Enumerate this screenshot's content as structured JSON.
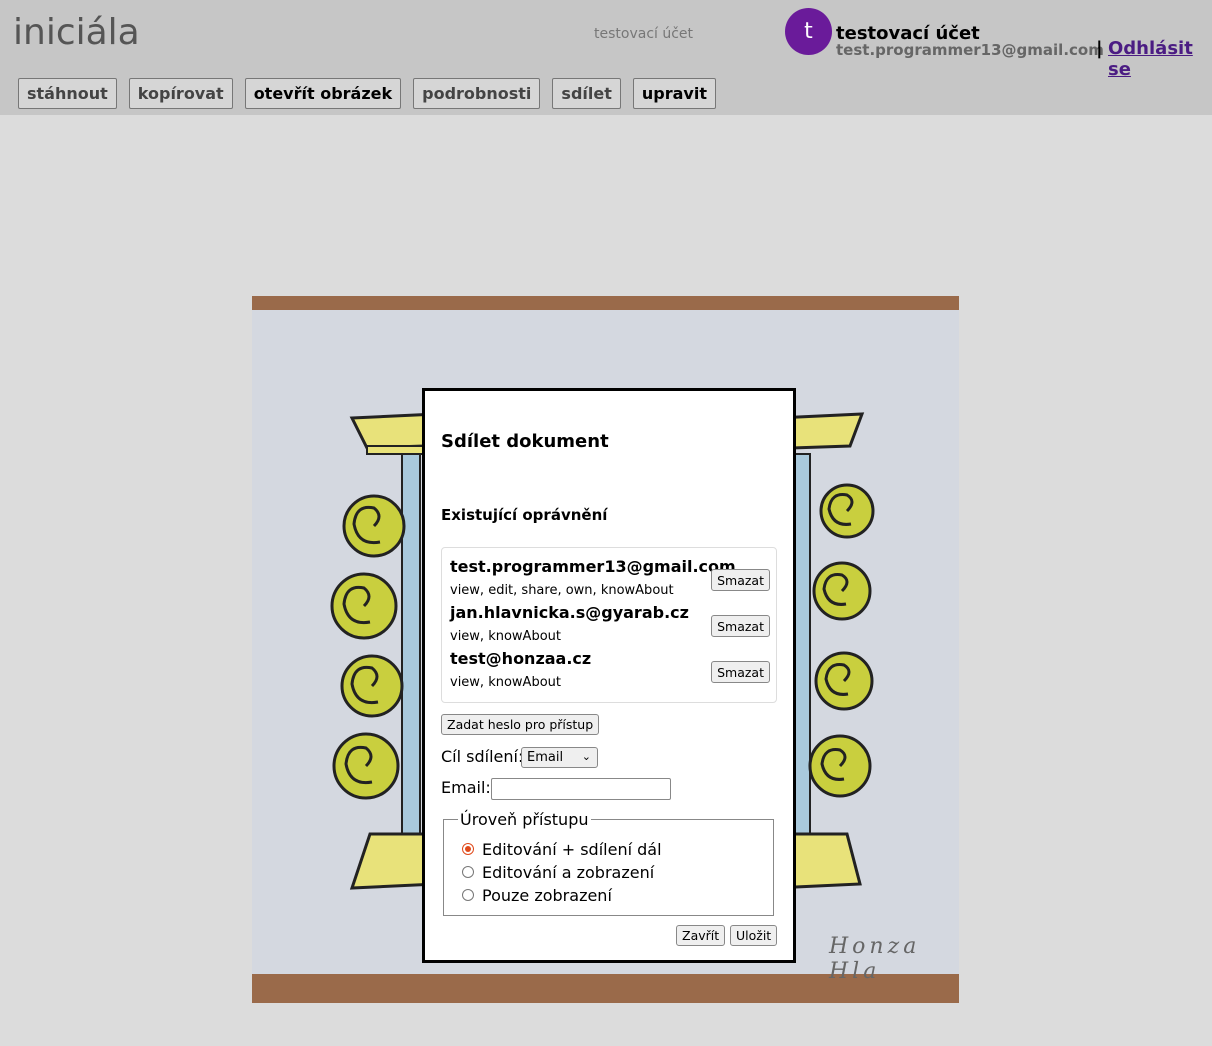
{
  "header": {
    "logo": "iniciála",
    "center_label": "testovací účet",
    "avatar_letter": "t",
    "user_name": "testovací účet",
    "user_email": "test.programmer13@gmail.com",
    "separator": "|",
    "logout": "Odhlásit se"
  },
  "toolbar": {
    "buttons": [
      "stáhnout",
      "kopírovat",
      "otevřít obrázek",
      "podrobnosti",
      "sdílet",
      "upravit"
    ]
  },
  "colors": {
    "header_bg": "#c6c6c6",
    "page_bg": "#dcdcdc",
    "avatar_bg": "#6a1b9a",
    "link": "#4b1c83",
    "radio_accent": "#e04a1b"
  },
  "image_caption": "Honza Hla",
  "dialog": {
    "title": "Sdílet dokument",
    "permissions_title": "Existující oprávnění",
    "permissions": [
      {
        "email": "test.programmer13@gmail.com",
        "rights": "view, edit, share, own, knowAbout",
        "delete_label": "Smazat"
      },
      {
        "email": "jan.hlavnicka.s@gyarab.cz",
        "rights": "view, knowAbout",
        "delete_label": "Smazat"
      },
      {
        "email": "test@honzaa.cz",
        "rights": "view, knowAbout",
        "delete_label": "Smazat"
      }
    ],
    "password_button": "Zadat heslo pro přístup",
    "target_label": "Cíl sdílení:",
    "target_selected": "Email",
    "email_label": "Email:",
    "email_value": "",
    "access_legend": "Úroveň přístupu",
    "access_options": [
      {
        "label": "Editování + sdílení dál",
        "checked": true
      },
      {
        "label": "Editování a zobrazení",
        "checked": false
      },
      {
        "label": "Pouze zobrazení",
        "checked": false
      }
    ],
    "close_button": "Zavřít",
    "save_button": "Uložit"
  }
}
